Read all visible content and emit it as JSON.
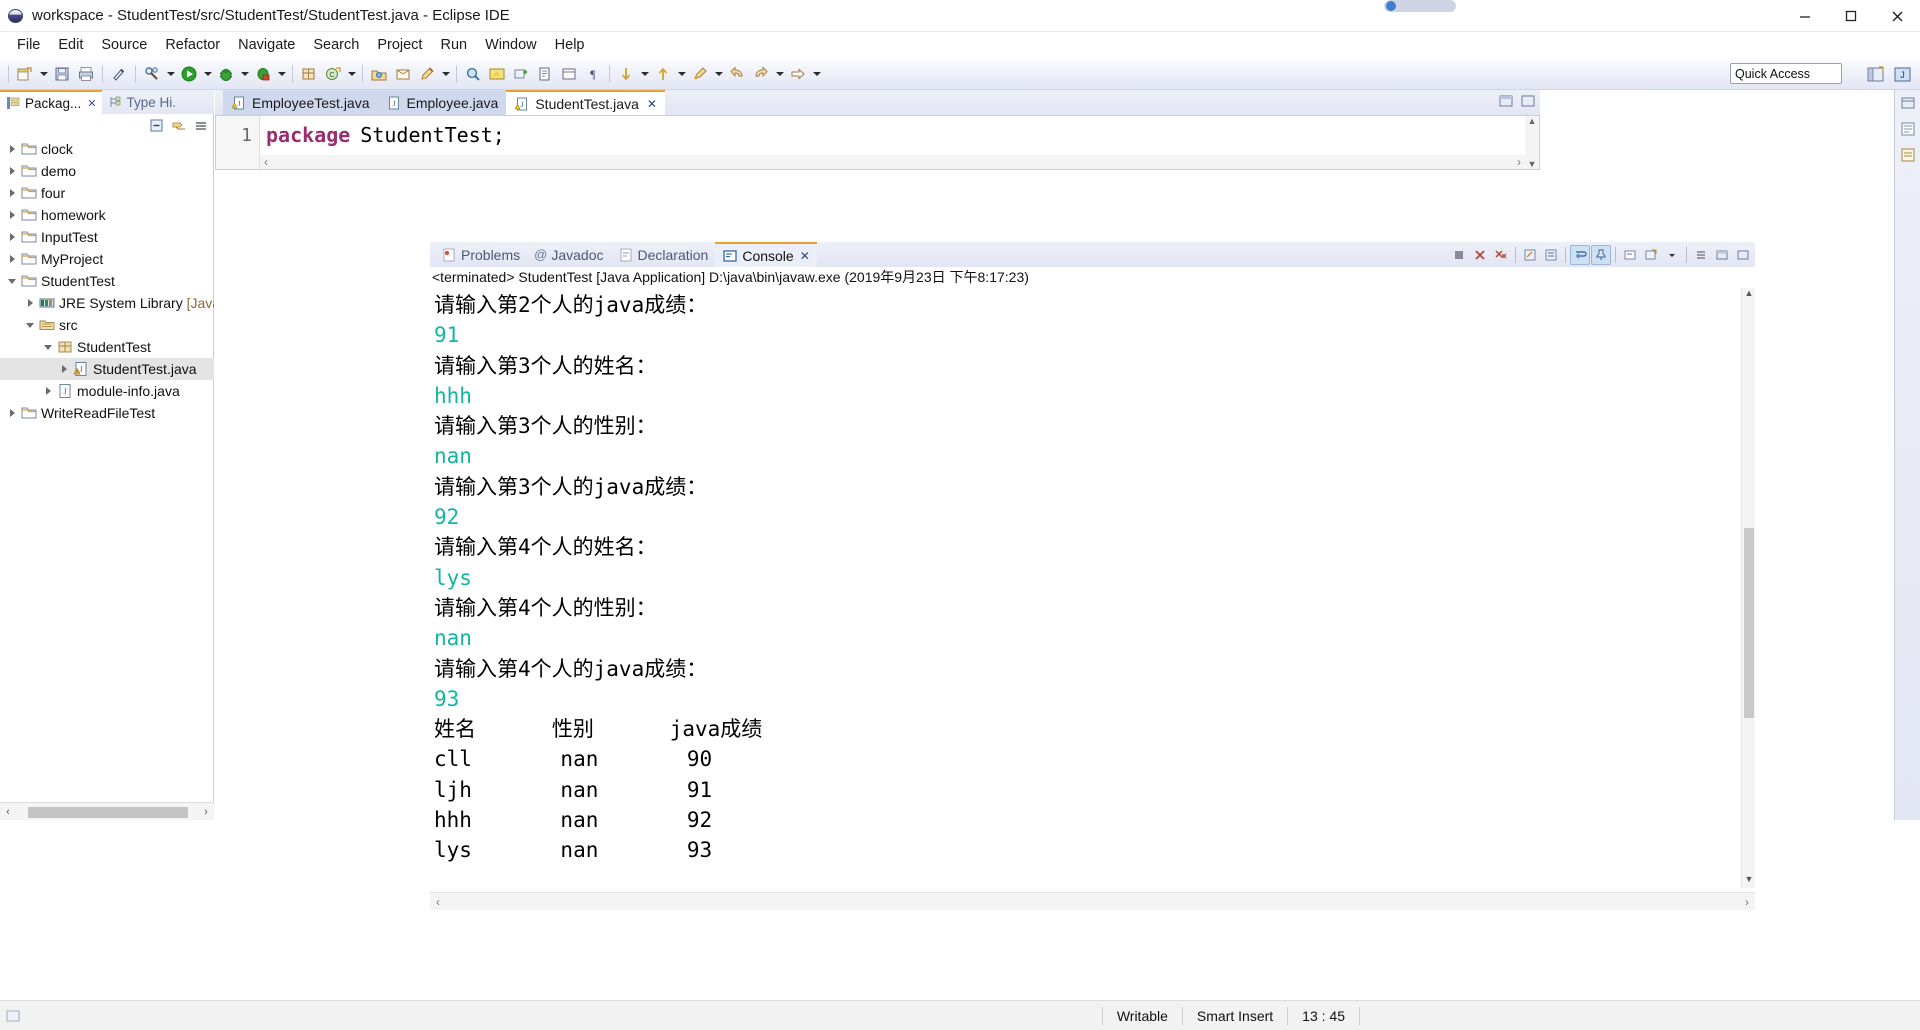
{
  "window": {
    "title": "workspace - StudentTest/src/StudentTest/StudentTest.java - Eclipse IDE",
    "app_icon": "eclipse-sphere-icon",
    "minimize_label": "Minimize",
    "maximize_label": "Maximize",
    "close_label": "Close"
  },
  "menubar": {
    "items": [
      {
        "label": "File"
      },
      {
        "label": "Edit"
      },
      {
        "label": "Source"
      },
      {
        "label": "Refactor"
      },
      {
        "label": "Navigate"
      },
      {
        "label": "Search"
      },
      {
        "label": "Project"
      },
      {
        "label": "Run"
      },
      {
        "label": "Window"
      },
      {
        "label": "Help"
      }
    ]
  },
  "toolbar": {
    "quick_access_label": "Quick Access",
    "buttons": [
      {
        "name": "new-wizard-icon"
      },
      {
        "name": "save-icon"
      },
      {
        "name": "print-icon"
      },
      {
        "name": "link-icon"
      },
      {
        "name": "build-icon"
      },
      {
        "name": "run-icon"
      },
      {
        "name": "debug-icon"
      },
      {
        "name": "coverage-icon"
      },
      {
        "name": "new-java-package-icon"
      },
      {
        "name": "new-class-icon"
      },
      {
        "name": "open-type-icon"
      },
      {
        "name": "search-icon"
      },
      {
        "name": "external-tools-icon"
      },
      {
        "name": "next-annotation-icon"
      },
      {
        "name": "previous-annotation-icon"
      },
      {
        "name": "last-edit-location-icon"
      },
      {
        "name": "back-icon"
      },
      {
        "name": "forward-icon"
      }
    ],
    "perspective_buttons": [
      {
        "name": "open-perspective-icon"
      },
      {
        "name": "java-perspective-icon"
      }
    ]
  },
  "package_explorer": {
    "tabs": [
      {
        "label": "Packag...",
        "icon": "package-explorer-icon",
        "active": true,
        "closable": true
      },
      {
        "label": "Type Hi.",
        "icon": "type-hierarchy-icon",
        "active": false,
        "closable": false
      }
    ],
    "view_tools": [
      {
        "name": "collapse-all-icon"
      },
      {
        "name": "link-with-editor-icon"
      },
      {
        "name": "view-menu-icon"
      }
    ],
    "tree": [
      {
        "label": "clock",
        "icon": "java-project-icon",
        "indent": 0,
        "expander": "collapsed",
        "selected": false
      },
      {
        "label": "demo",
        "icon": "java-project-icon",
        "indent": 0,
        "expander": "collapsed",
        "selected": false
      },
      {
        "label": "four",
        "icon": "java-project-icon",
        "indent": 0,
        "expander": "collapsed",
        "selected": false
      },
      {
        "label": "homework",
        "icon": "java-project-icon",
        "indent": 0,
        "expander": "collapsed",
        "selected": false
      },
      {
        "label": "InputTest",
        "icon": "java-project-icon",
        "indent": 0,
        "expander": "collapsed",
        "selected": false
      },
      {
        "label": "MyProject",
        "icon": "java-project-icon",
        "indent": 0,
        "expander": "collapsed",
        "selected": false
      },
      {
        "label": "StudentTest",
        "icon": "java-project-icon",
        "indent": 0,
        "expander": "expanded",
        "selected": false
      },
      {
        "label": "JRE System Library",
        "suffix": "[JavaSE",
        "icon": "jre-library-icon",
        "indent": 1,
        "expander": "collapsed",
        "selected": false
      },
      {
        "label": "src",
        "icon": "source-folder-icon",
        "indent": 1,
        "expander": "expanded",
        "selected": false
      },
      {
        "label": "StudentTest",
        "icon": "package-icon",
        "indent": 2,
        "expander": "expanded",
        "selected": false
      },
      {
        "label": "StudentTest.java",
        "icon": "java-file-warning-icon",
        "indent": 3,
        "expander": "collapsed",
        "selected": true
      },
      {
        "label": "module-info.java",
        "icon": "java-file-icon",
        "indent": 2,
        "expander": "collapsed",
        "selected": false
      },
      {
        "label": "WriteReadFileTest",
        "icon": "java-project-icon",
        "indent": 0,
        "expander": "collapsed",
        "selected": false
      }
    ]
  },
  "editor": {
    "tabs": [
      {
        "label": "EmployeeTest.java",
        "icon": "java-file-warning-icon",
        "active": false,
        "closable": false
      },
      {
        "label": "Employee.java",
        "icon": "java-file-icon",
        "active": false,
        "closable": false
      },
      {
        "label": "StudentTest.java",
        "icon": "java-file-warning-icon",
        "active": true,
        "closable": true
      }
    ],
    "code": {
      "line_number": "1",
      "keyword": "package",
      "rest": "StudentTest;"
    }
  },
  "console_view": {
    "tabs": [
      {
        "label": "Problems",
        "icon": "problems-icon",
        "active": false,
        "closable": false
      },
      {
        "label": "Javadoc",
        "icon": "javadoc-icon",
        "active": false,
        "closable": false
      },
      {
        "label": "Declaration",
        "icon": "declaration-icon",
        "active": false,
        "closable": false
      },
      {
        "label": "Console",
        "icon": "console-icon",
        "active": true,
        "closable": true
      }
    ],
    "toolbar_buttons": [
      {
        "name": "terminate-icon"
      },
      {
        "name": "remove-launch-icon"
      },
      {
        "name": "remove-all-terminated-icon"
      },
      {
        "name": "clear-console-icon"
      },
      {
        "name": "scroll-lock-icon"
      },
      {
        "name": "word-wrap-icon"
      },
      {
        "name": "pin-console-icon"
      },
      {
        "name": "display-selected-console-icon"
      },
      {
        "name": "open-console-icon"
      },
      {
        "name": "view-menu-icon"
      },
      {
        "name": "minimize-icon"
      },
      {
        "name": "maximize-icon"
      }
    ],
    "status_line": "<terminated> StudentTest [Java Application] D:\\java\\bin\\javaw.exe (2019年9月23日 下午8:17:23)",
    "output_lines": [
      {
        "text": "请输入第2个人的java成绩：",
        "kind": "prompt"
      },
      {
        "text": "91",
        "kind": "input"
      },
      {
        "text": "请输入第3个人的姓名：",
        "kind": "prompt"
      },
      {
        "text": "hhh",
        "kind": "input"
      },
      {
        "text": "请输入第3个人的性别：",
        "kind": "prompt"
      },
      {
        "text": "nan",
        "kind": "input"
      },
      {
        "text": "请输入第3个人的java成绩：",
        "kind": "prompt"
      },
      {
        "text": "92",
        "kind": "input"
      },
      {
        "text": "请输入第4个人的姓名：",
        "kind": "prompt"
      },
      {
        "text": "lys",
        "kind": "input"
      },
      {
        "text": "请输入第4个人的性别：",
        "kind": "prompt"
      },
      {
        "text": "nan",
        "kind": "input"
      },
      {
        "text": "请输入第4个人的java成绩：",
        "kind": "prompt"
      },
      {
        "text": "93",
        "kind": "input"
      },
      {
        "text": "姓名      性别      java成绩",
        "kind": "table"
      },
      {
        "text": "cll       nan       90",
        "kind": "table"
      },
      {
        "text": "ljh       nan       91",
        "kind": "table"
      },
      {
        "text": "hhh       nan       92",
        "kind": "table"
      },
      {
        "text": "lys       nan       93",
        "kind": "table"
      }
    ]
  },
  "statusbar": {
    "writable": "Writable",
    "insert_mode": "Smart Insert",
    "position": "13 : 45"
  },
  "colors": {
    "console_input": "#11b5a0",
    "keyword_magenta": "#9b2d6f",
    "tab_accent": "#f0a030",
    "selection_gray": "#e4e4e4"
  }
}
